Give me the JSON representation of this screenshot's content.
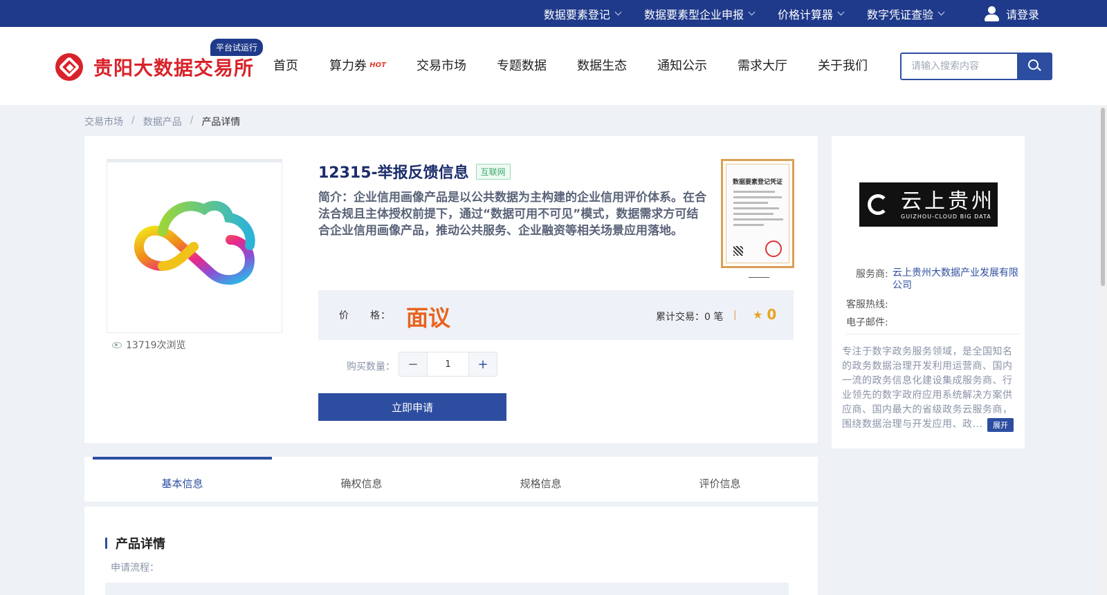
{
  "topbar": {
    "items": [
      {
        "label": "数据要素登记"
      },
      {
        "label": "数据要素型企业申报"
      },
      {
        "label": "价格计算器"
      },
      {
        "label": "数字凭证查验"
      }
    ],
    "login_label": "请登录"
  },
  "header": {
    "logo_text": "贵阳大数据交易所",
    "trial_badge": "平台试运行",
    "nav": [
      {
        "label": "首页"
      },
      {
        "label": "算力券",
        "badge": "HOT"
      },
      {
        "label": "交易市场"
      },
      {
        "label": "专题数据"
      },
      {
        "label": "数据生态"
      },
      {
        "label": "通知公示"
      },
      {
        "label": "需求大厅"
      },
      {
        "label": "关于我们"
      }
    ],
    "search_placeholder": "请输入搜索内容"
  },
  "breadcrumb": {
    "items": [
      "交易市场",
      "数据产品"
    ],
    "current": "产品详情",
    "separator": "/"
  },
  "product": {
    "title": "12315-举报反馈信息",
    "tag": "互联网",
    "intro": "简介：企业信用画像产品是以公共数据为主构建的企业信用评价体系。在合法合规且主体授权前提下，通过“数据可用不可见”模式，数据需求方可结合企业信用画像产品，推动公共服务、企业融资等相关场景应用落地。",
    "views": "13719次浏览",
    "certificate_title": "数据要素登记凭证",
    "price_label": "价　　格：",
    "price_value": "面议",
    "trade_count": "累计交易：0 笔",
    "separator": "|",
    "rating": "0",
    "quantity_label": "购买数量：",
    "quantity_value": "1",
    "minus": "−",
    "plus": "+",
    "apply_label": "立即申请"
  },
  "vendor": {
    "logo_text": "云上贵州",
    "logo_subtext": "GUIZHOU-CLOUD BIG DATA",
    "provider_label": "服务商:",
    "provider_name": "云上贵州大数据产业发展有限公司",
    "hotline_label": "客服热线:",
    "email_label": "电子邮件:",
    "description": "专注于数字政务服务领域，是全国知名的政务数据治理开发利用运营商、国内一流的政务信息化建设集成服务商、行业领先的数字政府应用系统解决方案供应商、国内最大的省级政务云服务商，围绕数据治理与开发应用、政...",
    "expand_label": "展开"
  },
  "tabs": [
    {
      "label": "基本信息",
      "active": true
    },
    {
      "label": "确权信息"
    },
    {
      "label": "规格信息"
    },
    {
      "label": "评价信息"
    }
  ],
  "details": {
    "section_title": "产品详情",
    "process_label": "申请流程："
  },
  "colors": {
    "brand_blue": "#1f3a8a",
    "accent_blue": "#2d4ea0",
    "logo_red": "#d8232a",
    "price_orange": "#e8631e"
  }
}
